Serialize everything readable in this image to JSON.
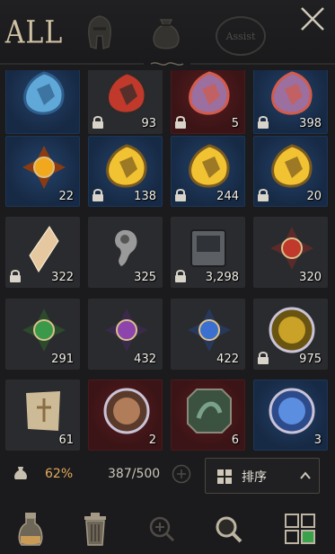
{
  "tabs": {
    "all_label": "ALL",
    "assist_label": "Assist",
    "icons": [
      "helmet-icon",
      "pouch-icon"
    ]
  },
  "inventory": {
    "slots": [
      {
        "art": "blue-crystal",
        "bg": "blue",
        "count": "",
        "locked": false
      },
      {
        "art": "dark-flame-gem",
        "bg": "gray",
        "count": "93",
        "locked": true
      },
      {
        "art": "rainbow-ore",
        "bg": "red",
        "count": "5",
        "locked": true
      },
      {
        "art": "rainbow-ore",
        "bg": "blue",
        "count": "398",
        "locked": true
      },
      {
        "art": "sun-star-gem",
        "bg": "blue",
        "count": "22",
        "locked": false
      },
      {
        "art": "golden-rainbow-ore",
        "bg": "blue",
        "count": "138",
        "locked": true
      },
      {
        "art": "golden-rainbow-ore",
        "bg": "blue",
        "count": "244",
        "locked": true
      },
      {
        "art": "golden-rainbow-ore",
        "bg": "blue",
        "count": "20",
        "locked": true
      },
      {
        "art": "crystal-shard",
        "bg": "gray",
        "count": "322",
        "locked": true
      },
      {
        "art": "gray-comma-stone",
        "bg": "gray",
        "count": "325",
        "locked": false
      },
      {
        "art": "tome-stack",
        "bg": "gray",
        "count": "3,298",
        "locked": true
      },
      {
        "art": "red-medal",
        "bg": "gray",
        "count": "320",
        "locked": false
      },
      {
        "art": "green-medal",
        "bg": "gray",
        "count": "291",
        "locked": false
      },
      {
        "art": "purple-medal",
        "bg": "gray",
        "count": "432",
        "locked": false
      },
      {
        "art": "blue-medal",
        "bg": "gray",
        "count": "422",
        "locked": false
      },
      {
        "art": "gold-book-seal",
        "bg": "gray",
        "count": "975",
        "locked": true
      },
      {
        "art": "treasure-map",
        "bg": "gray",
        "count": "61",
        "locked": false
      },
      {
        "art": "bronze-coin",
        "bg": "red",
        "count": "2",
        "locked": false
      },
      {
        "art": "dragon-plate",
        "bg": "red",
        "count": "6",
        "locked": false
      },
      {
        "art": "blue-coin",
        "bg": "blue",
        "count": "3",
        "locked": false
      }
    ]
  },
  "footer": {
    "weight_percent": "62%",
    "capacity": "387/500",
    "sort_label": "排序"
  },
  "colors": {
    "accent": "#e2aa5c",
    "lock": "#d9d4ca"
  }
}
